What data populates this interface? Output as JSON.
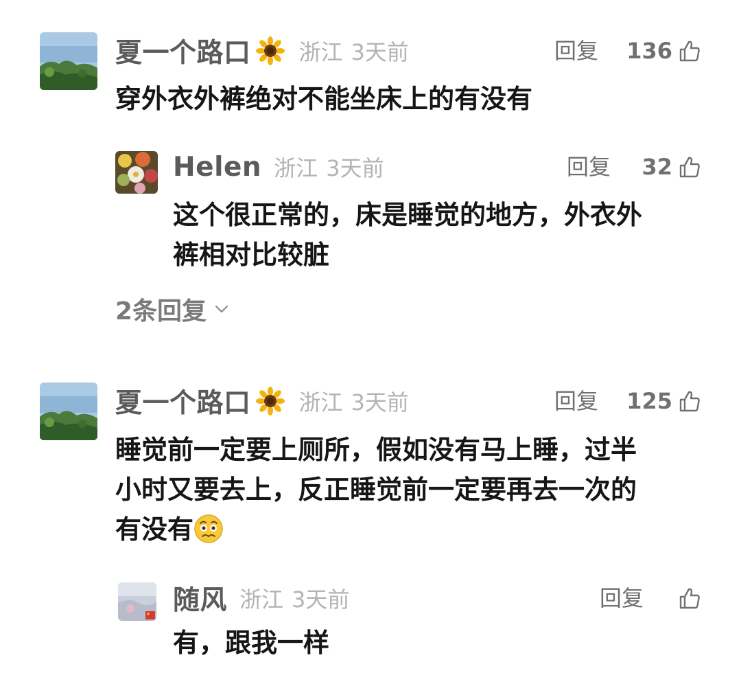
{
  "comments": [
    {
      "username": "夏一个路口",
      "badge_icon": "sunflower-icon",
      "location": "浙江",
      "time": "3天前",
      "reply_label": "回复",
      "likes": "136",
      "text": "穿外衣外裤绝对不能坐床上的有没有",
      "replies": [
        {
          "username": "Helen",
          "location": "浙江",
          "time": "3天前",
          "reply_label": "回复",
          "likes": "32",
          "text_line1": "这个很正常的，床是睡觉的地方，外衣外",
          "text_line2": "裤相对比较脏"
        }
      ],
      "more_replies_label": "2条回复"
    },
    {
      "username": "夏一个路口",
      "badge_icon": "sunflower-icon",
      "location": "浙江",
      "time": "3天前",
      "reply_label": "回复",
      "likes": "125",
      "text_line1": "睡觉前一定要上厕所，假如没有马上睡，过半",
      "text_line2": "小时又要去上，反正睡觉前一定要再去一次的",
      "text_line3": "有没有",
      "emoji": "woozy-face-icon",
      "replies": [
        {
          "username": "随风",
          "location": "浙江",
          "time": "3天前",
          "reply_label": "回复",
          "likes": "",
          "text": "有，跟我一样"
        }
      ]
    }
  ],
  "colors": {
    "text_primary": "#161616",
    "username": "#5b5b5b",
    "meta": "#b3b3b3",
    "action": "#707070"
  }
}
